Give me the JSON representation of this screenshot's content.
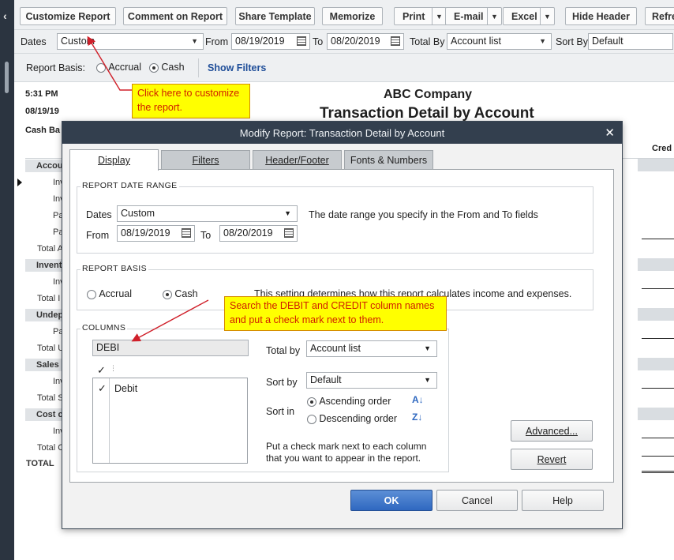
{
  "toolbar": {
    "customize_report": "Customize Report",
    "comment_on_report": "Comment on Report",
    "share_template": "Share Template",
    "memorize": "Memorize",
    "print": "Print",
    "email": "E-mail",
    "excel": "Excel",
    "hide_header": "Hide Header",
    "refresh": "Refre"
  },
  "filters": {
    "dates_label": "Dates",
    "dates_value": "Custom",
    "from_label": "From",
    "from_value": "08/19/2019",
    "to_label": "To",
    "to_value": "08/20/2019",
    "total_by_label": "Total By",
    "total_by_value": "Account list",
    "sort_by_label": "Sort By",
    "sort_by_value": "Default"
  },
  "basis": {
    "label": "Report Basis:",
    "accrual": "Accrual",
    "cash": "Cash",
    "show_filters": "Show Filters"
  },
  "report": {
    "time": "5:31 PM",
    "date": "08/19/19",
    "basis_short": "Cash Ba",
    "company": "ABC Company",
    "title": "Transaction Detail by Account",
    "right_header": "Cred",
    "rows": [
      "Accou",
      "Inv",
      "Inv",
      "Pa",
      "Pa",
      "Total A",
      "Invent",
      "Inv",
      "Total I",
      "Undep",
      "Pa",
      "Total U",
      "Sales",
      "Inv",
      "Total S",
      "Cost c",
      "Inv",
      "Total C",
      "TOTAL"
    ]
  },
  "callouts": {
    "customize": "Click here to customize the report.",
    "search": "Search the DEBIT and CREDIT column names and put a check mark next to them."
  },
  "dialog": {
    "title": "Modify Report: Transaction Detail by Account",
    "tabs": [
      "Display",
      "Filters",
      "Header/Footer",
      "Fonts & Numbers"
    ],
    "date_range": {
      "title": "REPORT DATE RANGE",
      "dates_label": "Dates",
      "dates_value": "Custom",
      "note": "The date range you specify in the From and To fields",
      "from_label": "From",
      "from_value": "08/19/2019",
      "to_label": "To",
      "to_value": "08/20/2019"
    },
    "basis": {
      "title": "REPORT BASIS",
      "accrual": "Accrual",
      "cash": "Cash",
      "note": "This setting determines how this report calculates income and expenses."
    },
    "columns": {
      "title": "COLUMNS",
      "search_value": "DEBI",
      "check_header": "✓",
      "items": [
        {
          "checked": "✓",
          "name": "Debit"
        }
      ],
      "total_by_label": "Total by",
      "total_by_value": "Account list",
      "sort_by_label": "Sort by",
      "sort_by_value": "Default",
      "sort_in_label": "Sort in",
      "ascending": "Ascending order",
      "descending": "Descending order",
      "help": "Put a check mark next to each column that you want to appear in the report."
    },
    "buttons": {
      "advanced": "Advanced...",
      "revert": "Revert",
      "ok": "OK",
      "cancel": "Cancel",
      "help": "Help"
    }
  },
  "colors": {
    "title_bar": "#333f4e",
    "callout_bg": "#ffff00",
    "callout_text": "#d02000",
    "link": "#1f4e99",
    "ok_button": "#2f68c0"
  }
}
